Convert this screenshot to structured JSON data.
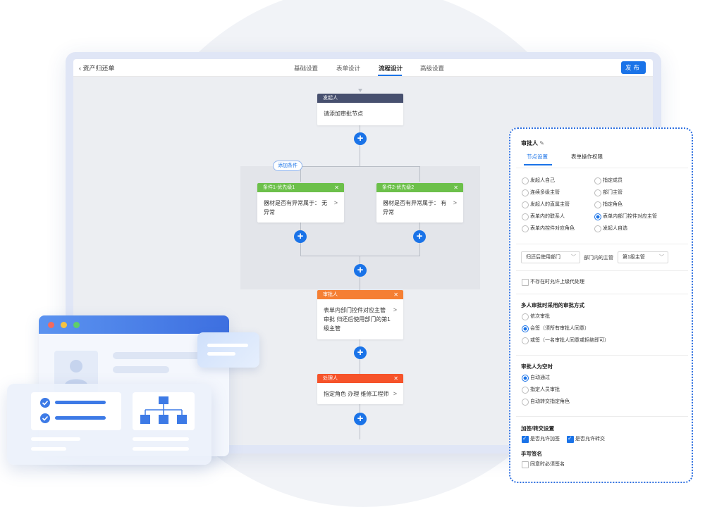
{
  "window": {
    "back_label": "资产归还单",
    "publish_label": "发布"
  },
  "tabs": [
    {
      "label": "基础设置"
    },
    {
      "label": "表单设计"
    },
    {
      "label": "流程设计",
      "active": true
    },
    {
      "label": "高级设置"
    }
  ],
  "flow": {
    "initiator": {
      "title": "发起人",
      "body": "请添加审批节点",
      "color": "#47506f"
    },
    "add_condition_label": "添加条件",
    "conditions": [
      {
        "title": "条件1-优先级1",
        "body": "器材是否有异常属于： 无异常",
        "color": "#6cc04a"
      },
      {
        "title": "条件2-优先级2",
        "body": "器材是否有异常属于： 有异常",
        "color": "#6cc04a"
      }
    ],
    "approver": {
      "title": "审批人",
      "body": "表单内部门控件对应主管 审批 归还后使用部门的第1级主管",
      "color": "#f57f33"
    },
    "handler": {
      "title": "处理人",
      "body": "指定角色 办理 维修工程师",
      "color": "#f6532a"
    },
    "close_symbol": "✕",
    "plus_symbol": "+"
  },
  "panel": {
    "title": "审批人",
    "tabs": [
      {
        "label": "节点设置",
        "active": true
      },
      {
        "label": "表单操作权限"
      }
    ],
    "approver_types": [
      {
        "label": "发起人自己"
      },
      {
        "label": "指定成员"
      },
      {
        "label": "连续多级主管"
      },
      {
        "label": "部门主管"
      },
      {
        "label": "发起人的直属主管"
      },
      {
        "label": "指定角色"
      },
      {
        "label": "表单内的联系人"
      },
      {
        "label": "表单内部门控件对应主管",
        "selected": true
      },
      {
        "label": "表单内控件对应角色"
      },
      {
        "label": "发起人自选"
      }
    ],
    "dept_select": "归还后使用部门",
    "middle_label": "部门内的主管",
    "level_select": "第1级主管",
    "fallback_label": "不存在时允许上级代处理",
    "multi_title": "多人审批时采用的审批方式",
    "multi_options": [
      {
        "label": "依次审批"
      },
      {
        "label": "会签（须所有审批人同意）",
        "selected": true
      },
      {
        "label": "或签（一名审批人同意或拒绝即可）"
      }
    ],
    "empty_title": "审批人为空时",
    "empty_options": [
      {
        "label": "自动通过",
        "selected": true
      },
      {
        "label": "指定人员审批"
      },
      {
        "label": "自动转交指定角色"
      }
    ],
    "sign_title": "加签/转交设置",
    "sign_options": [
      {
        "label": "是否允许加签",
        "checked": true
      },
      {
        "label": "是否允许转交",
        "checked": true
      }
    ],
    "handwrite_title": "手写签名",
    "handwrite_option": "同意时必须签名"
  },
  "colors": {
    "accent": "#1a73e8"
  }
}
